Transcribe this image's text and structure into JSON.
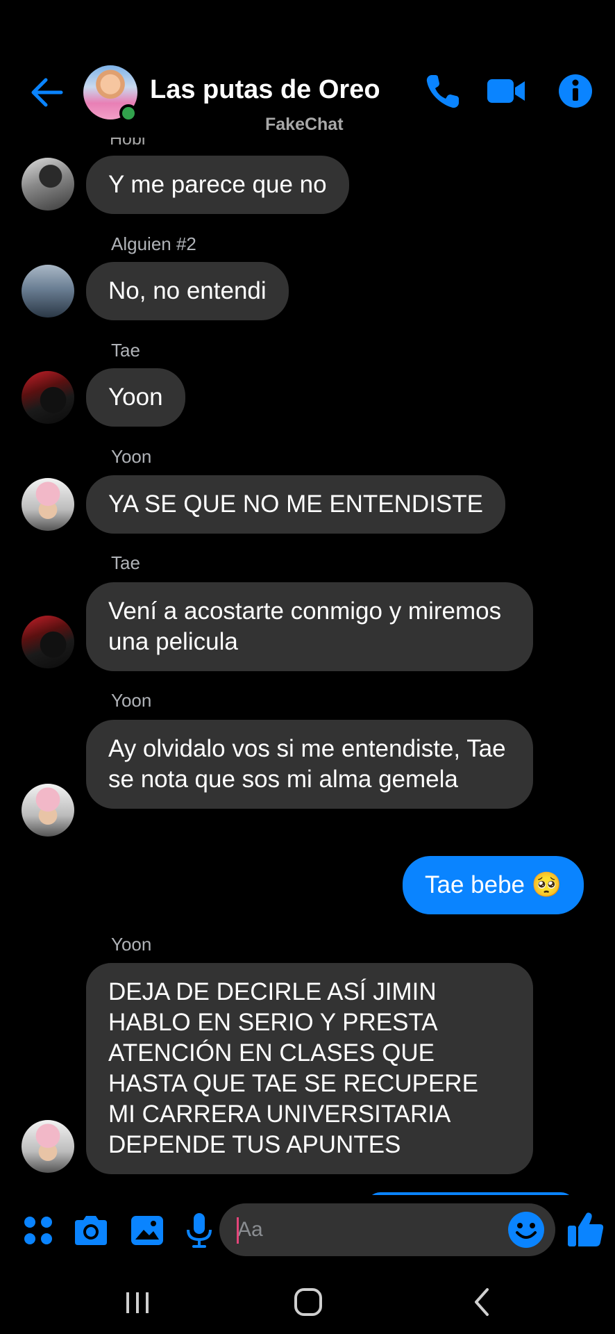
{
  "header": {
    "title": "Las putas de Oreo",
    "watermark": "FakeChat",
    "accent_color": "#0a84ff",
    "icons": [
      "back-arrow-icon",
      "phone-icon",
      "video-camera-icon",
      "info-icon"
    ]
  },
  "messages": [
    {
      "sender": "Hobi",
      "text": "Y me parece que no",
      "avatar": "avatar-hobi"
    },
    {
      "sender": "Alguien #2",
      "text": "No, no entendi",
      "avatar": "avatar-alguien"
    },
    {
      "sender": "Tae",
      "text": "Yoon",
      "avatar": "avatar-tae"
    },
    {
      "sender": "Yoon",
      "text": "YA SE QUE NO ME ENTENDISTE",
      "avatar": "avatar-yoon"
    },
    {
      "sender": "Tae",
      "text": "Vení a acostarte conmigo y miremos una pelicula",
      "avatar": "avatar-tae"
    },
    {
      "sender": "Yoon",
      "text": "Ay olvidalo vos si me entendiste, Tae se nota que sos mi alma gemela",
      "avatar": "avatar-yoon"
    },
    {
      "sender": "",
      "text": "Tae bebe 🥺",
      "mine": true
    },
    {
      "sender": "Yoon",
      "text": "DEJA DE DECIRLE ASÍ JIMIN HABLO EN SERIO Y PRESTA ATENCIÓN EN CLASES QUE HASTA QUE TAE SE RECUPERE MI CARRERA UNIVERSITARIA DEPENDE TUS APUNTES",
      "avatar": "avatar-yoon"
    }
  ],
  "composer": {
    "placeholder": "Aa",
    "icons": [
      "apps-icon",
      "camera-icon",
      "gallery-icon",
      "microphone-icon",
      "emoji-icon",
      "thumbs-up-icon"
    ]
  },
  "colors": {
    "background": "#000000",
    "bubble_other": "#333333",
    "bubble_mine": "#0a84ff",
    "online": "#31a24c"
  }
}
